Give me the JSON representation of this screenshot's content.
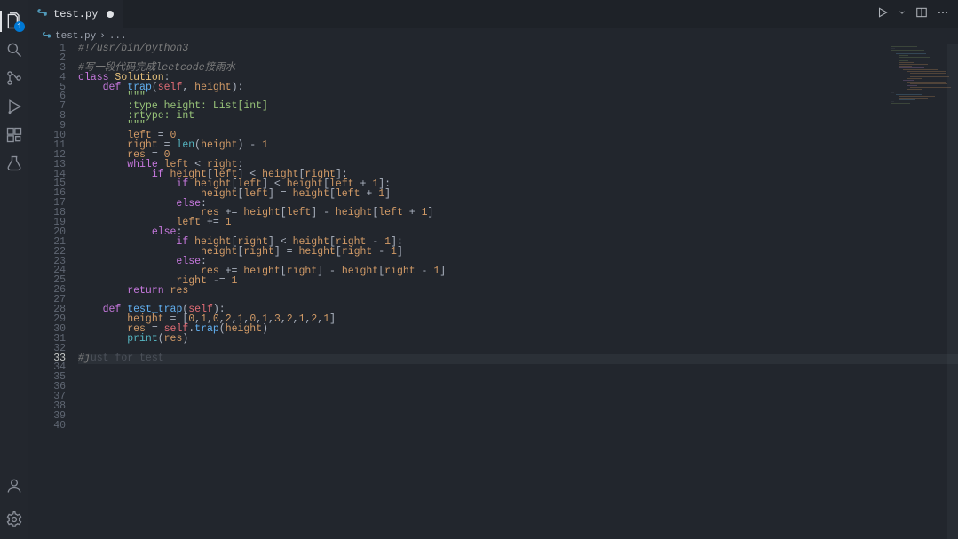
{
  "activity": {
    "explorer_badge": "1"
  },
  "tab": {
    "filename": "test.py",
    "dirty": true
  },
  "breadcrumbs": {
    "file": "test.py",
    "more": "..."
  },
  "code": {
    "lines": [
      {
        "n": 1,
        "tokens": [
          [
            "cmt",
            "#!/usr/bin/python3"
          ]
        ]
      },
      {
        "n": 2,
        "tokens": []
      },
      {
        "n": 3,
        "tokens": [
          [
            "cmt",
            "#写一段代码完成leetcode接雨水"
          ]
        ]
      },
      {
        "n": 4,
        "tokens": [
          [
            "kw",
            "class"
          ],
          [
            "pun",
            " "
          ],
          [
            "cls",
            "Solution"
          ],
          [
            "pun",
            ":"
          ]
        ]
      },
      {
        "n": 5,
        "tokens": [
          [
            "pun",
            "    "
          ],
          [
            "kw",
            "def"
          ],
          [
            "pun",
            " "
          ],
          [
            "fn",
            "trap"
          ],
          [
            "pun",
            "("
          ],
          [
            "sel",
            "self"
          ],
          [
            "pun",
            ", "
          ],
          [
            "prm",
            "height"
          ],
          [
            "pun",
            "):"
          ]
        ]
      },
      {
        "n": 6,
        "tokens": [
          [
            "pun",
            "        "
          ],
          [
            "str",
            "\"\"\""
          ]
        ]
      },
      {
        "n": 7,
        "tokens": [
          [
            "pun",
            "        "
          ],
          [
            "str",
            ":type height: List[int]"
          ]
        ]
      },
      {
        "n": 8,
        "tokens": [
          [
            "pun",
            "        "
          ],
          [
            "str",
            ":rtype: int"
          ]
        ]
      },
      {
        "n": 9,
        "tokens": [
          [
            "pun",
            "        "
          ],
          [
            "str",
            "\"\"\""
          ]
        ]
      },
      {
        "n": 10,
        "tokens": [
          [
            "pun",
            "        "
          ],
          [
            "var",
            "left"
          ],
          [
            "pun",
            " = "
          ],
          [
            "num",
            "0"
          ]
        ]
      },
      {
        "n": 11,
        "tokens": [
          [
            "pun",
            "        "
          ],
          [
            "var",
            "right"
          ],
          [
            "pun",
            " = "
          ],
          [
            "bi",
            "len"
          ],
          [
            "pun",
            "("
          ],
          [
            "var",
            "height"
          ],
          [
            "pun",
            ") - "
          ],
          [
            "num",
            "1"
          ]
        ]
      },
      {
        "n": 12,
        "tokens": [
          [
            "pun",
            "        "
          ],
          [
            "var",
            "res"
          ],
          [
            "pun",
            " = "
          ],
          [
            "num",
            "0"
          ]
        ]
      },
      {
        "n": 13,
        "tokens": [
          [
            "pun",
            "        "
          ],
          [
            "kw",
            "while"
          ],
          [
            "pun",
            " "
          ],
          [
            "var",
            "left"
          ],
          [
            "pun",
            " < "
          ],
          [
            "var",
            "right"
          ],
          [
            "pun",
            ":"
          ]
        ]
      },
      {
        "n": 14,
        "tokens": [
          [
            "pun",
            "            "
          ],
          [
            "kw",
            "if"
          ],
          [
            "pun",
            " "
          ],
          [
            "var",
            "height"
          ],
          [
            "pun",
            "["
          ],
          [
            "var",
            "left"
          ],
          [
            "pun",
            "] < "
          ],
          [
            "var",
            "height"
          ],
          [
            "pun",
            "["
          ],
          [
            "var",
            "right"
          ],
          [
            "pun",
            "]:"
          ]
        ]
      },
      {
        "n": 15,
        "tokens": [
          [
            "pun",
            "                "
          ],
          [
            "kw",
            "if"
          ],
          [
            "pun",
            " "
          ],
          [
            "var",
            "height"
          ],
          [
            "pun",
            "["
          ],
          [
            "var",
            "left"
          ],
          [
            "pun",
            "] < "
          ],
          [
            "var",
            "height"
          ],
          [
            "pun",
            "["
          ],
          [
            "var",
            "left"
          ],
          [
            "pun",
            " + "
          ],
          [
            "num",
            "1"
          ],
          [
            "pun",
            "]:"
          ]
        ]
      },
      {
        "n": 16,
        "tokens": [
          [
            "pun",
            "                    "
          ],
          [
            "var",
            "height"
          ],
          [
            "pun",
            "["
          ],
          [
            "var",
            "left"
          ],
          [
            "pun",
            "] = "
          ],
          [
            "var",
            "height"
          ],
          [
            "pun",
            "["
          ],
          [
            "var",
            "left"
          ],
          [
            "pun",
            " + "
          ],
          [
            "num",
            "1"
          ],
          [
            "pun",
            "]"
          ]
        ]
      },
      {
        "n": 17,
        "tokens": [
          [
            "pun",
            "                "
          ],
          [
            "kw",
            "else"
          ],
          [
            "pun",
            ":"
          ]
        ]
      },
      {
        "n": 18,
        "tokens": [
          [
            "pun",
            "                    "
          ],
          [
            "var",
            "res"
          ],
          [
            "pun",
            " += "
          ],
          [
            "var",
            "height"
          ],
          [
            "pun",
            "["
          ],
          [
            "var",
            "left"
          ],
          [
            "pun",
            "] - "
          ],
          [
            "var",
            "height"
          ],
          [
            "pun",
            "["
          ],
          [
            "var",
            "left"
          ],
          [
            "pun",
            " + "
          ],
          [
            "num",
            "1"
          ],
          [
            "pun",
            "]"
          ]
        ]
      },
      {
        "n": 19,
        "tokens": [
          [
            "pun",
            "                "
          ],
          [
            "var",
            "left"
          ],
          [
            "pun",
            " += "
          ],
          [
            "num",
            "1"
          ]
        ]
      },
      {
        "n": 20,
        "tokens": [
          [
            "pun",
            "            "
          ],
          [
            "kw",
            "else"
          ],
          [
            "pun",
            ":"
          ]
        ]
      },
      {
        "n": 21,
        "tokens": [
          [
            "pun",
            "                "
          ],
          [
            "kw",
            "if"
          ],
          [
            "pun",
            " "
          ],
          [
            "var",
            "height"
          ],
          [
            "pun",
            "["
          ],
          [
            "var",
            "right"
          ],
          [
            "pun",
            "] < "
          ],
          [
            "var",
            "height"
          ],
          [
            "pun",
            "["
          ],
          [
            "var",
            "right"
          ],
          [
            "pun",
            " - "
          ],
          [
            "num",
            "1"
          ],
          [
            "pun",
            "]:"
          ]
        ]
      },
      {
        "n": 22,
        "tokens": [
          [
            "pun",
            "                    "
          ],
          [
            "var",
            "height"
          ],
          [
            "pun",
            "["
          ],
          [
            "var",
            "right"
          ],
          [
            "pun",
            "] = "
          ],
          [
            "var",
            "height"
          ],
          [
            "pun",
            "["
          ],
          [
            "var",
            "right"
          ],
          [
            "pun",
            " - "
          ],
          [
            "num",
            "1"
          ],
          [
            "pun",
            "]"
          ]
        ]
      },
      {
        "n": 23,
        "tokens": [
          [
            "pun",
            "                "
          ],
          [
            "kw",
            "else"
          ],
          [
            "pun",
            ":"
          ]
        ]
      },
      {
        "n": 24,
        "tokens": [
          [
            "pun",
            "                    "
          ],
          [
            "var",
            "res"
          ],
          [
            "pun",
            " += "
          ],
          [
            "var",
            "height"
          ],
          [
            "pun",
            "["
          ],
          [
            "var",
            "right"
          ],
          [
            "pun",
            "] - "
          ],
          [
            "var",
            "height"
          ],
          [
            "pun",
            "["
          ],
          [
            "var",
            "right"
          ],
          [
            "pun",
            " - "
          ],
          [
            "num",
            "1"
          ],
          [
            "pun",
            "]"
          ]
        ]
      },
      {
        "n": 25,
        "tokens": [
          [
            "pun",
            "                "
          ],
          [
            "var",
            "right"
          ],
          [
            "pun",
            " -= "
          ],
          [
            "num",
            "1"
          ]
        ]
      },
      {
        "n": 26,
        "tokens": [
          [
            "pun",
            "        "
          ],
          [
            "kw",
            "return"
          ],
          [
            "pun",
            " "
          ],
          [
            "var",
            "res"
          ]
        ]
      },
      {
        "n": 27,
        "tokens": []
      },
      {
        "n": 28,
        "tokens": [
          [
            "pun",
            "    "
          ],
          [
            "kw",
            "def"
          ],
          [
            "pun",
            " "
          ],
          [
            "fn",
            "test_trap"
          ],
          [
            "pun",
            "("
          ],
          [
            "sel",
            "self"
          ],
          [
            "pun",
            "):"
          ]
        ]
      },
      {
        "n": 29,
        "tokens": [
          [
            "pun",
            "        "
          ],
          [
            "var",
            "height"
          ],
          [
            "pun",
            " = ["
          ],
          [
            "num",
            "0"
          ],
          [
            "pun",
            ","
          ],
          [
            "num",
            "1"
          ],
          [
            "pun",
            ","
          ],
          [
            "num",
            "0"
          ],
          [
            "pun",
            ","
          ],
          [
            "num",
            "2"
          ],
          [
            "pun",
            ","
          ],
          [
            "num",
            "1"
          ],
          [
            "pun",
            ","
          ],
          [
            "num",
            "0"
          ],
          [
            "pun",
            ","
          ],
          [
            "num",
            "1"
          ],
          [
            "pun",
            ","
          ],
          [
            "num",
            "3"
          ],
          [
            "pun",
            ","
          ],
          [
            "num",
            "2"
          ],
          [
            "pun",
            ","
          ],
          [
            "num",
            "1"
          ],
          [
            "pun",
            ","
          ],
          [
            "num",
            "2"
          ],
          [
            "pun",
            ","
          ],
          [
            "num",
            "1"
          ],
          [
            "pun",
            "]"
          ]
        ]
      },
      {
        "n": 30,
        "tokens": [
          [
            "pun",
            "        "
          ],
          [
            "var",
            "res"
          ],
          [
            "pun",
            " = "
          ],
          [
            "sel",
            "self"
          ],
          [
            "pun",
            "."
          ],
          [
            "fn",
            "trap"
          ],
          [
            "pun",
            "("
          ],
          [
            "var",
            "height"
          ],
          [
            "pun",
            ")"
          ]
        ]
      },
      {
        "n": 31,
        "tokens": [
          [
            "pun",
            "        "
          ],
          [
            "bi",
            "print"
          ],
          [
            "pun",
            "("
          ],
          [
            "var",
            "res"
          ],
          [
            "pun",
            ")"
          ]
        ]
      },
      {
        "n": 32,
        "tokens": []
      },
      {
        "n": 33,
        "tokens": [
          [
            "cmt",
            "#j"
          ],
          [
            "ghost",
            "ust for test"
          ]
        ],
        "current": true
      },
      {
        "n": 34,
        "tokens": []
      },
      {
        "n": 35,
        "tokens": []
      },
      {
        "n": 36,
        "tokens": []
      },
      {
        "n": 37,
        "tokens": []
      },
      {
        "n": 38,
        "tokens": []
      },
      {
        "n": 39,
        "tokens": []
      },
      {
        "n": 40,
        "tokens": []
      }
    ]
  }
}
